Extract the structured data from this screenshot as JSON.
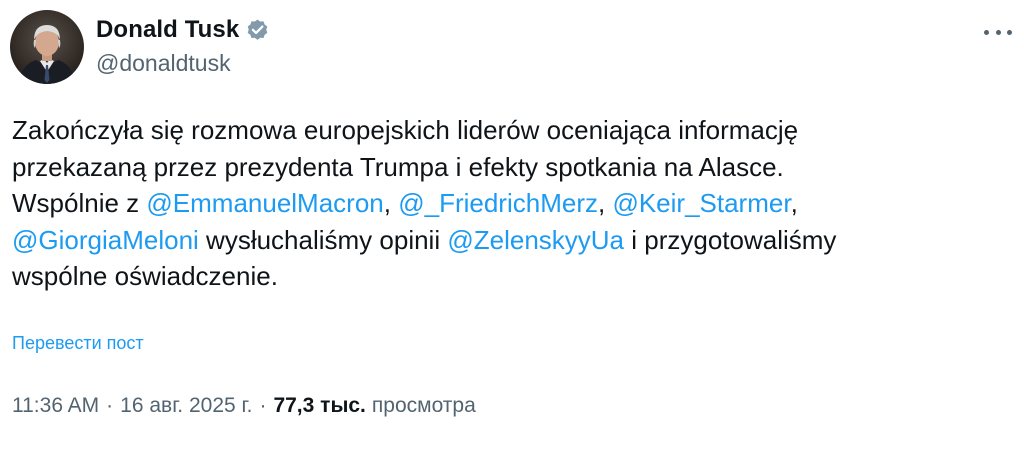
{
  "author": {
    "display_name": "Donald Tusk",
    "handle": "@donaldtusk",
    "verified_icon": "verified-badge-icon",
    "verified_color": "#829aab"
  },
  "more_icon": "more-options-icon",
  "text": {
    "line1": "Zakończyła się rozmowa europejskich liderów oceniająca informację",
    "line2": "przekazaną przez prezydenta Trumpa i efekty spotkania na Alasce.",
    "line3_prefix": "Wspólnie z ",
    "mention_1": "@EmmanuelMacron",
    "sep_1": ", ",
    "mention_2": "@_FriedrichMerz",
    "sep_2": ", ",
    "mention_3": "@Keir_Starmer",
    "sep_3": ",",
    "mention_4": "@GiorgiaMeloni",
    "mid_text": " wysłuchaliśmy opinii ",
    "mention_5": "@ZelenskyyUa",
    "after_mention_5": " i przygotowaliśmy",
    "line6": "wspólne oświadczenie."
  },
  "translate_label": "Перевести пост",
  "meta": {
    "time": "11:36 AM",
    "separator": "·",
    "date": "16 авг. 2025 г.",
    "views_count": "77,3 тыс.",
    "views_label": "просмотра"
  },
  "colors": {
    "link": "#1d9bf0",
    "text": "#0f1419",
    "secondary": "#536471"
  }
}
